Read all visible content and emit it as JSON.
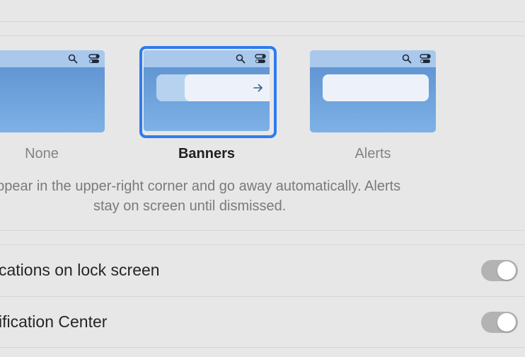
{
  "alert_styles": [
    {
      "id": "none",
      "label": "None",
      "selected": false
    },
    {
      "id": "banners",
      "label": "Banners",
      "selected": true
    },
    {
      "id": "alerts",
      "label": "Alerts",
      "selected": false
    }
  ],
  "description": {
    "line1": "appear in the upper-right corner and go away automatically. Alerts",
    "line2": "stay on screen until dismissed."
  },
  "settings": [
    {
      "label": "cations on lock screen",
      "toggle_on": false
    },
    {
      "label": "ification Center",
      "toggle_on": false
    }
  ],
  "icons": {
    "menubar": [
      "search-icon",
      "control-center-icon"
    ],
    "banner": "arrow-right-icon"
  },
  "colors": {
    "accent": "#2f7bf0",
    "desktop_top": "#5a8fce",
    "desktop_bottom": "#7db1e6",
    "toggle_off": "#b3b3b3"
  }
}
